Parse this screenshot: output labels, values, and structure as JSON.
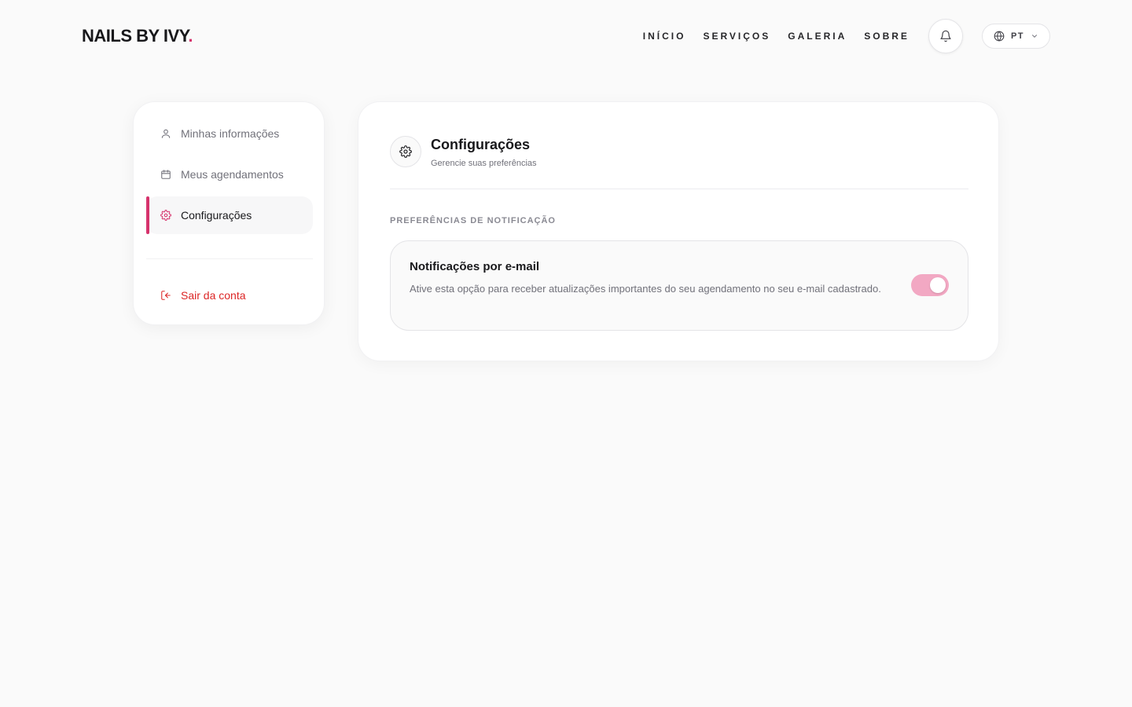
{
  "brand": {
    "name": "NAILS BY IVY",
    "dot": ".",
    "accent": "#d6336c"
  },
  "nav": {
    "links": [
      "INÍCIO",
      "SERVIÇOS",
      "GALERIA",
      "SOBRE"
    ],
    "notification_icon": "bell-icon",
    "language": {
      "code": "PT",
      "icon": "globe-icon",
      "caret": "chevron-down-icon"
    }
  },
  "sidebar": {
    "items": [
      {
        "label": "Minhas informações",
        "icon": "user-icon",
        "active": false
      },
      {
        "label": "Meus agendamentos",
        "icon": "calendar-icon",
        "active": false
      },
      {
        "label": "Configurações",
        "icon": "gear-icon",
        "active": true
      }
    ],
    "logout": {
      "label": "Sair da conta",
      "icon": "logout-icon",
      "color": "#dc2626"
    }
  },
  "settings": {
    "icon": "gear-icon",
    "title": "Configurações",
    "subtitle": "Gerencie suas preferências",
    "section_label": "PREFERÊNCIAS DE NOTIFICAÇÃO",
    "email_notifications": {
      "title": "Notificações por e-mail",
      "description": "Ative esta opção para receber atualizações importantes do seu agendamento no seu e-mail cadastrado.",
      "enabled": true,
      "toggle_color": "#f2a8c3"
    }
  }
}
